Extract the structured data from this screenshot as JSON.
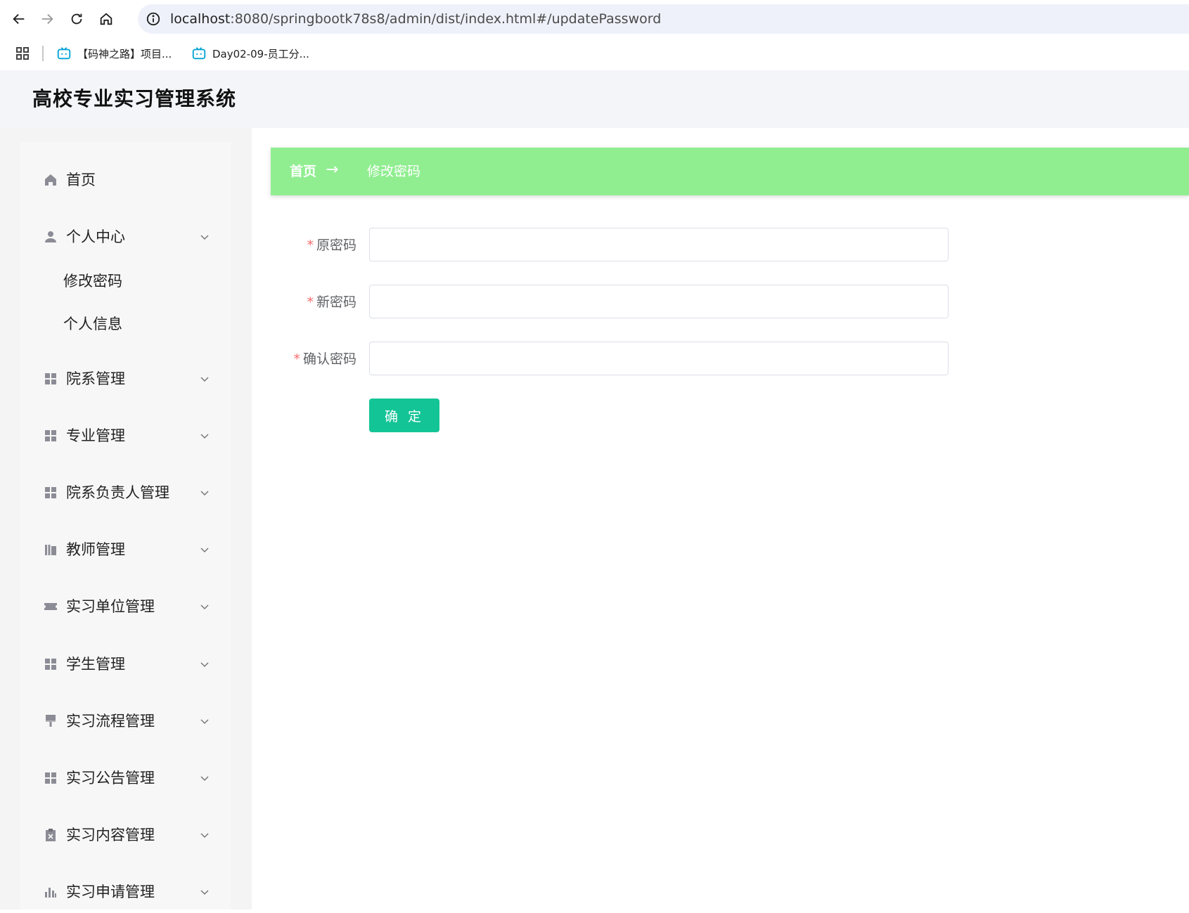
{
  "browser": {
    "url_host": "localhost",
    "url_rest": ":8080/springbootk78s8/admin/dist/index.html#/updatePassword",
    "bookmarks": [
      {
        "label": "【码神之路】项目...",
        "icon": "bilibili-icon"
      },
      {
        "label": "Day02-09-员工分...",
        "icon": "bilibili-icon"
      }
    ]
  },
  "header": {
    "title": "高校专业实习管理系统"
  },
  "sidebar": {
    "items": [
      {
        "label": "首页",
        "icon": "home-icon"
      },
      {
        "label": "个人中心",
        "icon": "user-icon"
      },
      {
        "label": "院系管理",
        "icon": "grid-icon"
      },
      {
        "label": "专业管理",
        "icon": "grid-icon"
      },
      {
        "label": "院系负责人管理",
        "icon": "grid-icon"
      },
      {
        "label": "教师管理",
        "icon": "library-icon"
      },
      {
        "label": "实习单位管理",
        "icon": "ticket-icon"
      },
      {
        "label": "学生管理",
        "icon": "grid-icon"
      },
      {
        "label": "实习流程管理",
        "icon": "brush-icon"
      },
      {
        "label": "实习公告管理",
        "icon": "grid-icon"
      },
      {
        "label": "实习内容管理",
        "icon": "clipboard-icon"
      },
      {
        "label": "实习申请管理",
        "icon": "bar-chart-icon"
      }
    ],
    "submenu": [
      {
        "label": "修改密码"
      },
      {
        "label": "个人信息"
      }
    ]
  },
  "breadcrumb": {
    "home": "首页",
    "arrow": "→",
    "current": "修改密码"
  },
  "form": {
    "required_mark": "*",
    "fields": [
      {
        "label": "原密码",
        "value": ""
      },
      {
        "label": "新密码",
        "value": ""
      },
      {
        "label": "确认密码",
        "value": ""
      }
    ],
    "submit_label": "确 定"
  },
  "colors": {
    "breadcrumb_bg": "#90ee90",
    "submit_bg": "#13c496",
    "required": "#f56c6c"
  }
}
